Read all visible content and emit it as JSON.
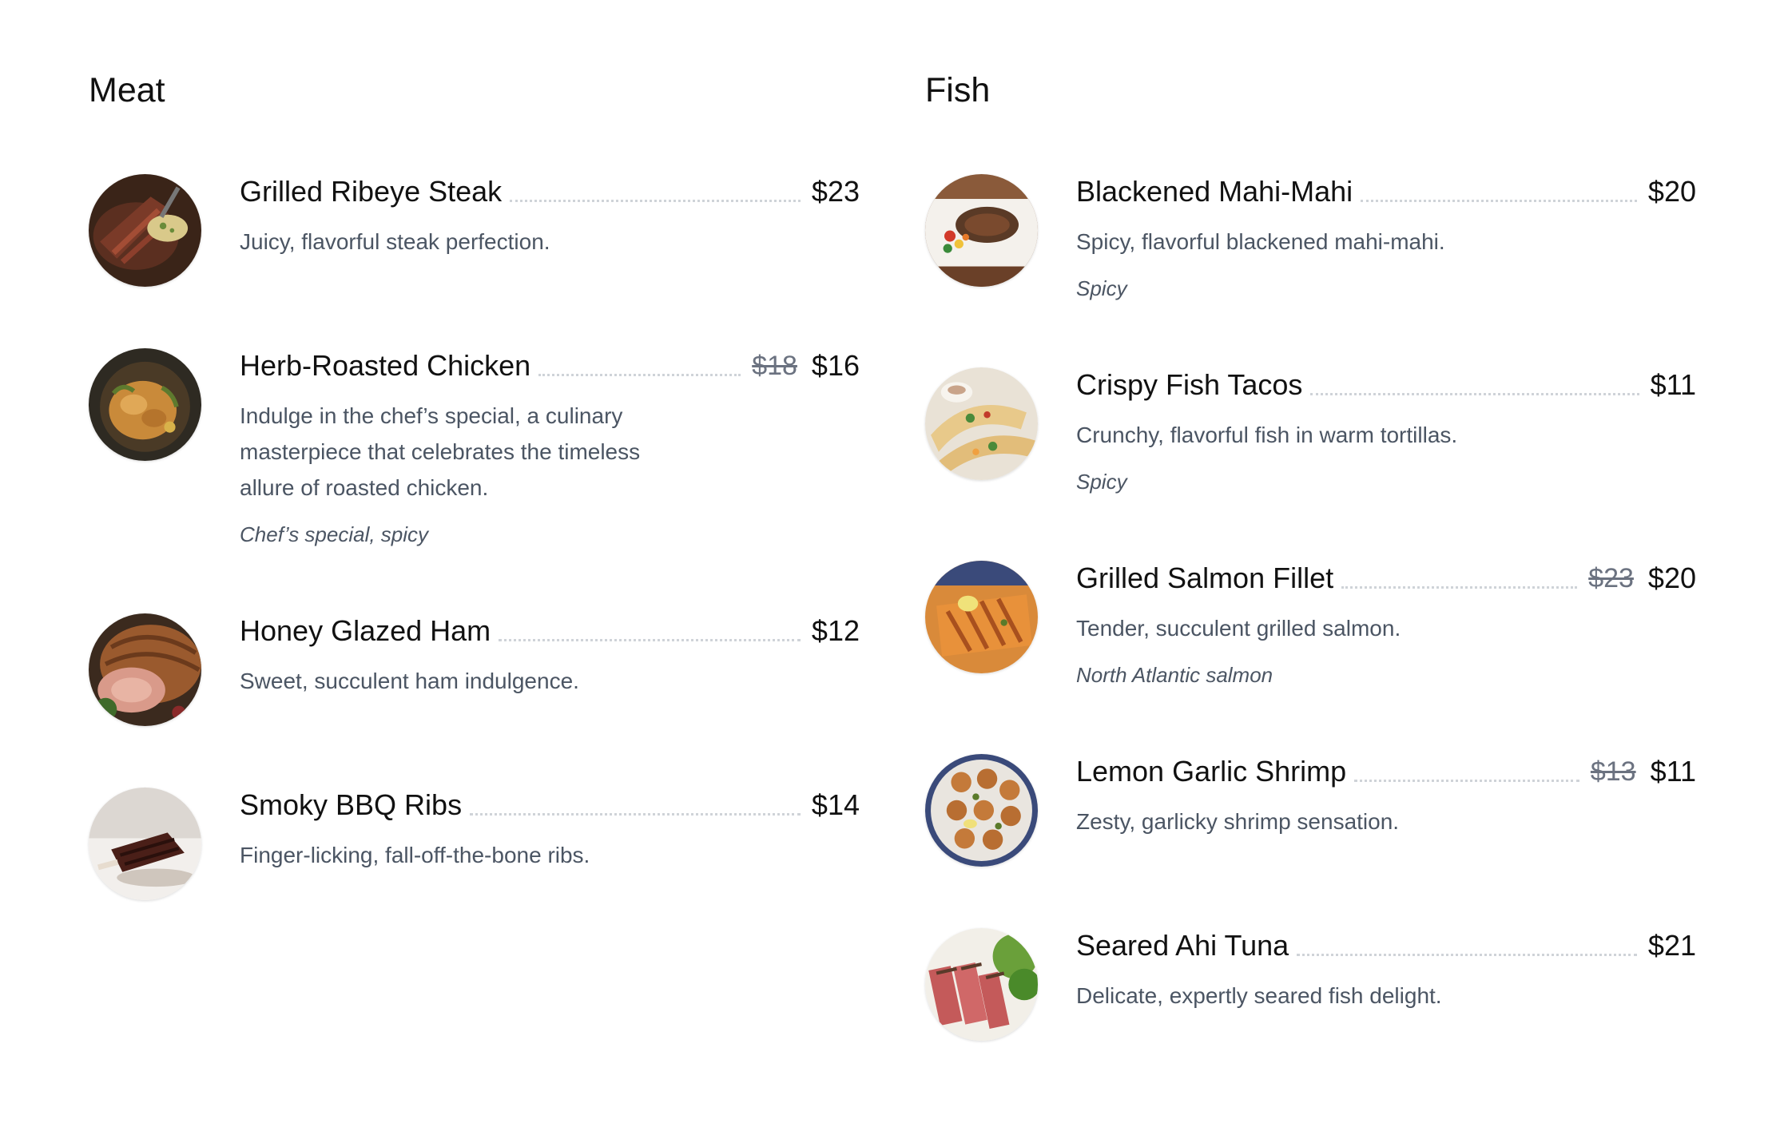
{
  "sections": {
    "meat": {
      "title": "Meat",
      "items": [
        {
          "name": "Grilled Ribeye Steak",
          "price": "$23",
          "old_price": "",
          "description": "Juicy, flavorful steak perfection.",
          "note": "",
          "image": "steak-photo"
        },
        {
          "name": "Herb-Roasted Chicken",
          "price": "$16",
          "old_price": "$18",
          "description": "Indulge in the chef’s special, a culinary masterpiece that celebrates the timeless allure of roasted chicken.",
          "note": "Chef’s special, spicy",
          "image": "roast-chicken-photo"
        },
        {
          "name": "Honey Glazed Ham",
          "price": "$12",
          "old_price": "",
          "description": "Sweet, succulent ham indulgence.",
          "note": "",
          "image": "ham-photo"
        },
        {
          "name": "Smoky BBQ Ribs",
          "price": "$14",
          "old_price": "",
          "description": "Finger-licking, fall-off-the-bone ribs.",
          "note": "",
          "image": "ribs-photo"
        }
      ]
    },
    "fish": {
      "title": "Fish",
      "items": [
        {
          "name": "Blackened Mahi-Mahi",
          "price": "$20",
          "old_price": "",
          "description": "Spicy, flavorful blackened mahi-mahi.",
          "note": "Spicy",
          "image": "mahi-mahi-photo"
        },
        {
          "name": "Crispy Fish Tacos",
          "price": "$11",
          "old_price": "",
          "description": "Crunchy, flavorful fish in warm tortillas.",
          "note": "Spicy",
          "image": "fish-tacos-photo"
        },
        {
          "name": "Grilled Salmon Fillet",
          "price": "$20",
          "old_price": "$23",
          "description": "Tender, succulent grilled salmon.",
          "note": "North Atlantic salmon",
          "image": "salmon-photo"
        },
        {
          "name": "Lemon Garlic Shrimp",
          "price": "$11",
          "old_price": "$13",
          "description": "Zesty, garlicky shrimp sensation.",
          "note": "",
          "image": "shrimp-photo"
        },
        {
          "name": "Seared Ahi Tuna",
          "price": "$21",
          "old_price": "",
          "description": "Delicate, expertly seared fish delight.",
          "note": "",
          "image": "tuna-photo"
        }
      ]
    }
  },
  "colors": {
    "text": "#111111",
    "muted": "#4b5563",
    "leader": "#cfd3d8",
    "background": "#ffffff"
  }
}
